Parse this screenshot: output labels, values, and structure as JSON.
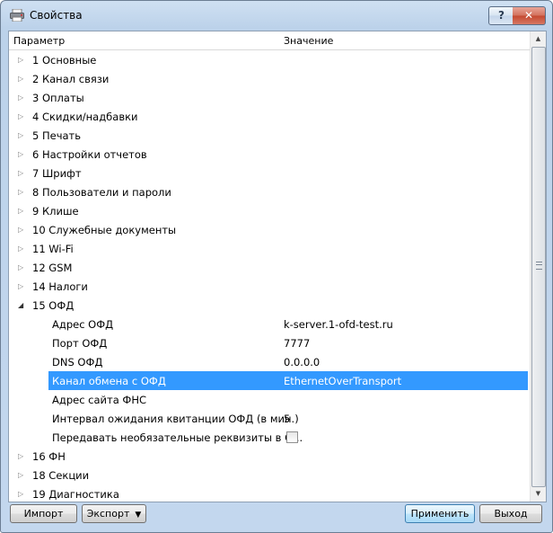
{
  "window": {
    "title": "Свойства",
    "help_label": "?",
    "close_label": "✕"
  },
  "grid": {
    "col_param": "Параметр",
    "col_value": "Значение",
    "rows": [
      {
        "label": "1 Основные",
        "expanded": false,
        "level": 0
      },
      {
        "label": "2 Канал связи",
        "expanded": false,
        "level": 0
      },
      {
        "label": "3 Оплаты",
        "expanded": false,
        "level": 0
      },
      {
        "label": "4 Скидки/надбавки",
        "expanded": false,
        "level": 0
      },
      {
        "label": "5 Печать",
        "expanded": false,
        "level": 0
      },
      {
        "label": "6 Настройки отчетов",
        "expanded": false,
        "level": 0
      },
      {
        "label": "7 Шрифт",
        "expanded": false,
        "level": 0
      },
      {
        "label": "8 Пользователи и пароли",
        "expanded": false,
        "level": 0
      },
      {
        "label": "9 Клише",
        "expanded": false,
        "level": 0
      },
      {
        "label": "10 Служебные документы",
        "expanded": false,
        "level": 0
      },
      {
        "label": "11 Wi-Fi",
        "expanded": false,
        "level": 0
      },
      {
        "label": "12 GSM",
        "expanded": false,
        "level": 0
      },
      {
        "label": "14 Налоги",
        "expanded": false,
        "level": 0
      },
      {
        "label": "15 ОФД",
        "expanded": true,
        "level": 0
      },
      {
        "label": "Адрес ОФД",
        "value": "k-server.1-ofd-test.ru",
        "level": 1
      },
      {
        "label": "Порт ОФД",
        "value": "7777",
        "level": 1
      },
      {
        "label": "DNS ОФД",
        "value": "0.0.0.0",
        "level": 1
      },
      {
        "label": "Канал обмена с ОФД",
        "value": "EthernetOverTransport",
        "level": 1,
        "selected": true
      },
      {
        "label": "Адрес сайта ФНС",
        "value": "",
        "level": 1
      },
      {
        "label": "Интервал ожидания квитанции ОФД (в мин.)",
        "value": "5",
        "level": 1
      },
      {
        "label": "Передавать необязательные реквизиты в О...",
        "checkbox": true,
        "checked": false,
        "level": 1
      },
      {
        "label": "16 ФН",
        "expanded": false,
        "level": 0
      },
      {
        "label": "18 Секции",
        "expanded": false,
        "level": 0
      },
      {
        "label": "19 Диагностика",
        "expanded": false,
        "level": 0
      }
    ]
  },
  "buttons": {
    "import": "Импорт",
    "export": "Экспорт",
    "apply": "Применить",
    "exit": "Выход"
  },
  "icons": {
    "collapsed": "▷",
    "expanded": "◢",
    "dropdown": "▼",
    "scroll_up": "▲",
    "scroll_down": "▼"
  },
  "colors": {
    "selection": "#3399ff"
  }
}
